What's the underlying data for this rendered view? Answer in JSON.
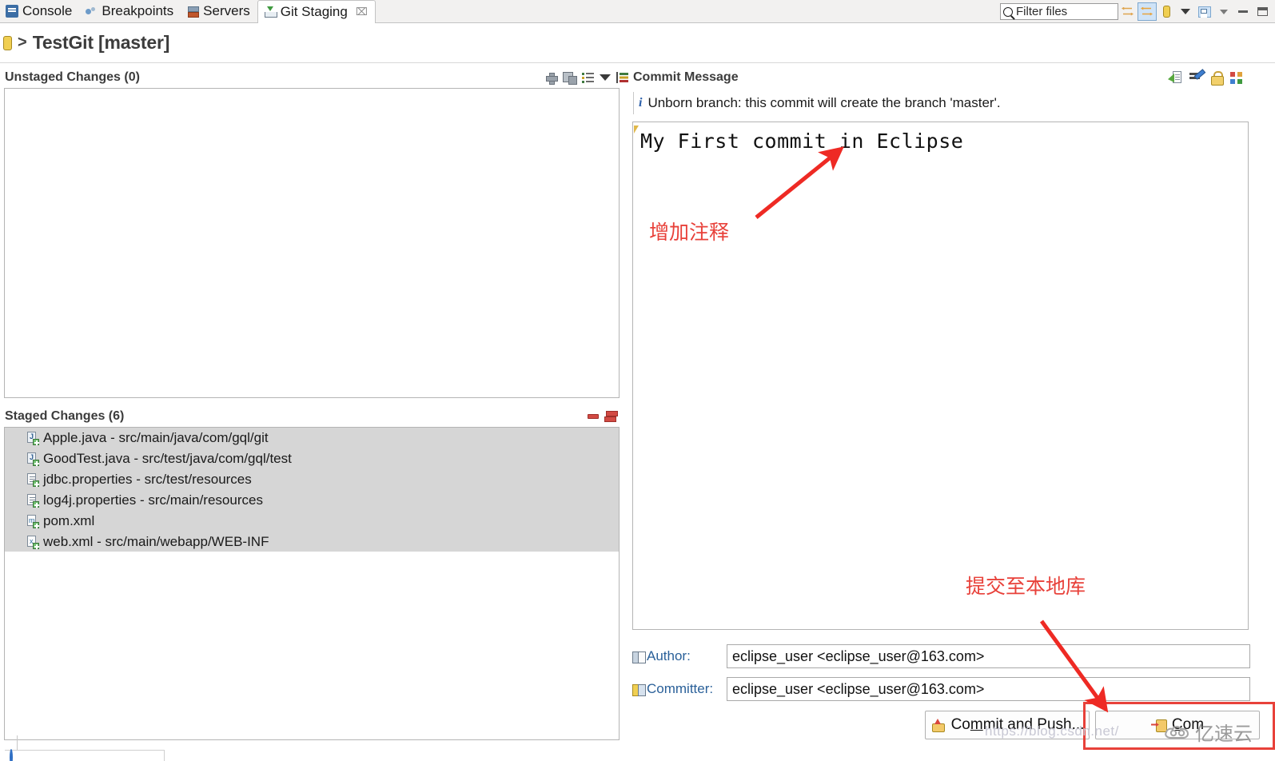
{
  "window": {
    "tabs": [
      {
        "label": "Console",
        "icon": "console-icon",
        "active": false
      },
      {
        "label": "Breakpoints",
        "icon": "breakpoints-icon",
        "active": false
      },
      {
        "label": "Servers",
        "icon": "servers-icon",
        "active": false
      },
      {
        "label": "Git Staging",
        "icon": "git-staging-icon",
        "active": true,
        "close": "⌧"
      }
    ],
    "filter": {
      "placeholder": "Filter files",
      "value": "",
      "icon": "search-icon"
    },
    "toolbar": [
      {
        "name": "link-selection-icon",
        "label": ""
      },
      {
        "name": "synchronize-icon",
        "label": "",
        "selected": true
      },
      {
        "name": "repository-icon",
        "label": ""
      },
      {
        "name": "view-menu-caret-icon",
        "label": ""
      },
      {
        "name": "restore-perspective-icon",
        "label": "",
        "selected": true
      },
      {
        "name": "view-menu-icon",
        "label": ""
      },
      {
        "name": "minimize-icon",
        "label": ""
      },
      {
        "name": "maximize-icon",
        "label": ""
      }
    ]
  },
  "breadcrumb": {
    "repo_icon": "repository-icon",
    "separator": ">",
    "title": "TestGit [master]"
  },
  "unstaged": {
    "title": "Unstaged Changes (0)",
    "tools": [
      {
        "name": "stage-selected-icon"
      },
      {
        "name": "stage-all-icon"
      },
      {
        "name": "list-presentation-icon"
      },
      {
        "name": "presentation-menu-caret-icon"
      },
      {
        "name": "sort-icon"
      }
    ],
    "items": []
  },
  "staged": {
    "title": "Staged Changes (6)",
    "tools": [
      {
        "name": "unstage-selected-icon"
      },
      {
        "name": "unstage-all-icon"
      }
    ],
    "items": [
      {
        "name": "Apple.java",
        "path": "src/main/java/com/gql/git",
        "icon": "java-added-icon",
        "kind": "java"
      },
      {
        "name": "GoodTest.java",
        "path": "src/test/java/com/gql/test",
        "icon": "java-added-icon",
        "kind": "java"
      },
      {
        "name": "jdbc.properties",
        "path": "src/test/resources",
        "icon": "properties-added-icon",
        "kind": "props"
      },
      {
        "name": "log4j.properties",
        "path": "src/main/resources",
        "icon": "properties-added-icon",
        "kind": "props"
      },
      {
        "name": "pom.xml",
        "path": "",
        "icon": "pom-added-icon",
        "kind": "pom"
      },
      {
        "name": "web.xml",
        "path": "src/main/webapp/WEB-INF",
        "icon": "xml-added-icon",
        "kind": "xml"
      }
    ],
    "separator": " - "
  },
  "commit": {
    "title": "Commit Message",
    "tools": [
      {
        "name": "amend-commit-icon"
      },
      {
        "name": "add-signed-off-by-icon"
      },
      {
        "name": "sign-commit-icon"
      },
      {
        "name": "add-change-id-icon"
      }
    ],
    "info": {
      "icon": "info-icon",
      "glyph": "i",
      "text": "Unborn branch: this commit will create the branch 'master'."
    },
    "message": "My First commit in Eclipse",
    "author": {
      "label": "Author:",
      "icon": "author-icon",
      "value": "eclipse_user <eclipse_user@163.com>"
    },
    "committer": {
      "label": "Committer:",
      "icon": "committer-icon",
      "value": "eclipse_user <eclipse_user@163.com>"
    },
    "buttons": [
      {
        "name": "commit-and-push-button",
        "label": "Commit and Push...",
        "mnemonic": "m",
        "icon": "push-icon"
      },
      {
        "name": "commit-button",
        "label": "Com",
        "icon": "commit-icon"
      }
    ]
  },
  "annotations": [
    {
      "name": "annotation-add-comment",
      "text": "增加注释",
      "color": "#e8413a"
    },
    {
      "name": "annotation-commit-to-local-repo",
      "text": "提交至本地库",
      "color": "#e8413a"
    }
  ],
  "watermark": {
    "text": "亿速云",
    "url": "https://blog.csdn.net/"
  },
  "colors": {
    "accent_red": "#e8413a",
    "link_blue": "#2a6099",
    "selection_gray": "#d6d6d6",
    "panel_border": "#b4b4b4"
  }
}
